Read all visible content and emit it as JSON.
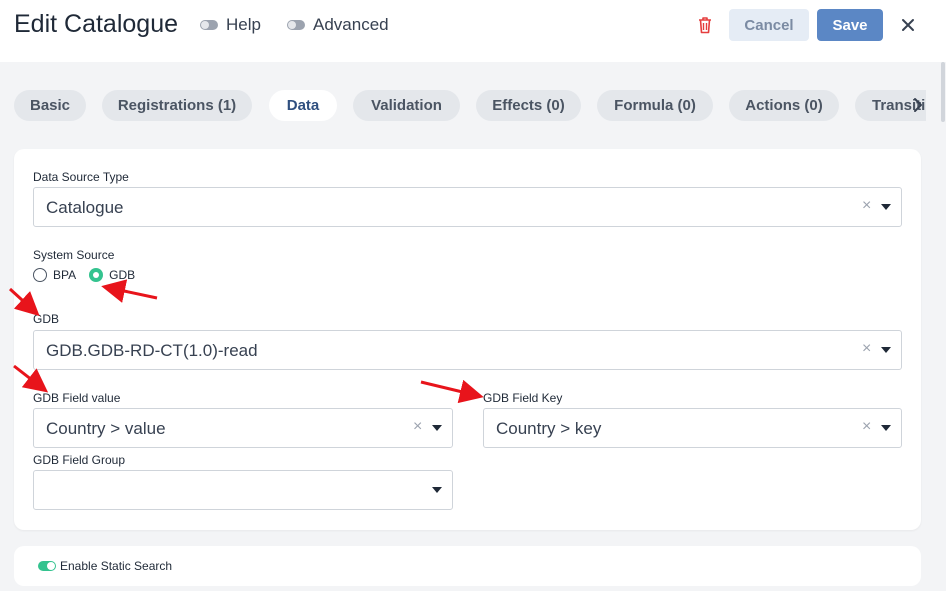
{
  "header": {
    "title": "Edit Catalogue",
    "help_label": "Help",
    "advanced_label": "Advanced",
    "cancel_label": "Cancel",
    "save_label": "Save"
  },
  "tabs": [
    {
      "label": "Basic"
    },
    {
      "label": "Registrations (1)"
    },
    {
      "label": "Data",
      "active": true
    },
    {
      "label": "Validation"
    },
    {
      "label": "Effects (0)"
    },
    {
      "label": "Formula (0)"
    },
    {
      "label": "Actions (0)"
    },
    {
      "label": "Transitions"
    }
  ],
  "form": {
    "data_source_type": {
      "label": "Data Source Type",
      "value": "Catalogue"
    },
    "system_source": {
      "label": "System Source",
      "options": [
        "BPA",
        "GDB"
      ],
      "selected": "GDB"
    },
    "gdb": {
      "label": "GDB",
      "value": "GDB.GDB-RD-CT(1.0)-read"
    },
    "gdb_field_value": {
      "label": "GDB Field value",
      "value": "Country > value"
    },
    "gdb_field_key": {
      "label": "GDB Field Key",
      "value": "Country > key"
    },
    "gdb_field_group": {
      "label": "GDB Field Group",
      "value": ""
    }
  },
  "static_search": {
    "label": "Enable Static Search",
    "enabled": true
  },
  "colors": {
    "accent": "#5b87c5",
    "success": "#34c38f",
    "annotation": "#e8141b",
    "danger": "#e53e3e"
  },
  "icons": [
    "trash-icon",
    "close-icon",
    "chevron-right-icon",
    "clear-icon",
    "caret-down-icon"
  ]
}
